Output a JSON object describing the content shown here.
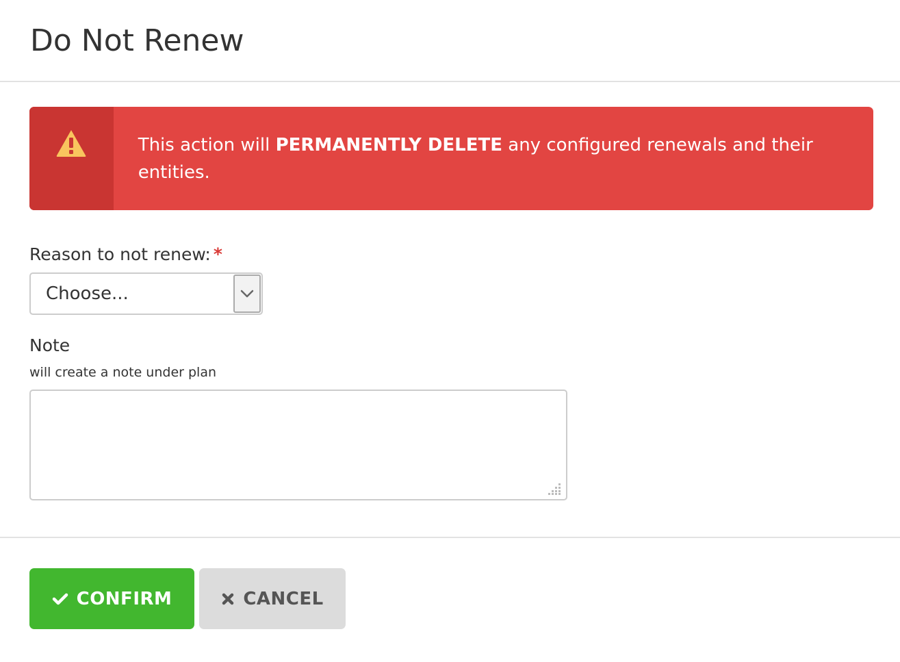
{
  "dialog": {
    "title": "Do Not Renew"
  },
  "alert": {
    "text_before": "This action will ",
    "text_bold": "PERMANENTLY DELETE",
    "text_after": " any configured renewals and their entities.",
    "icon": "warning-triangle-icon",
    "colors": {
      "background": "#e24542",
      "icon_column": "#c93532",
      "icon_fill": "#f9c45e"
    }
  },
  "reason": {
    "label": "Reason to not renew:",
    "required_marker": "*",
    "selected_value": "Choose..."
  },
  "note": {
    "label": "Note",
    "help_text": "will create a note under plan",
    "value": ""
  },
  "buttons": {
    "confirm_label": "CONFIRM",
    "confirm_icon": "check-icon",
    "cancel_label": "CANCEL",
    "cancel_icon": "close-icon",
    "colors": {
      "confirm": "#42b72f",
      "cancel": "#dcdcdc"
    }
  }
}
